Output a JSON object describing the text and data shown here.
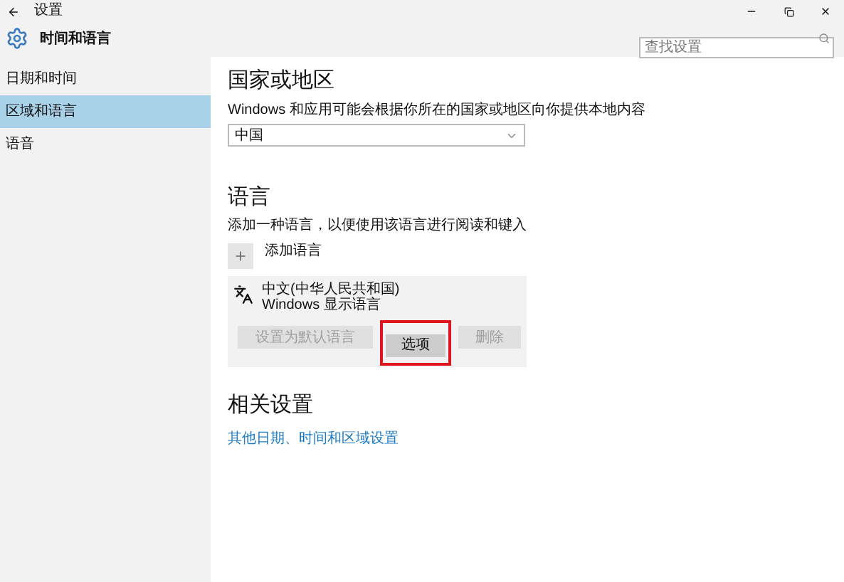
{
  "window": {
    "title": "设置"
  },
  "header": {
    "title": "时间和语言",
    "search": {
      "placeholder": "查找设置"
    }
  },
  "sidebar": {
    "items": [
      {
        "label": "日期和时间",
        "selected": false
      },
      {
        "label": "区域和语言",
        "selected": true
      },
      {
        "label": "语音",
        "selected": false
      }
    ]
  },
  "region": {
    "heading": "国家或地区",
    "description": "Windows 和应用可能会根据你所在的国家或地区向你提供本地内容",
    "dropdown": {
      "value": "中国"
    }
  },
  "language": {
    "heading": "语言",
    "description": "添加一种语言，以便使用该语言进行阅读和键入",
    "add_label": "添加语言",
    "items": [
      {
        "name": "中文(中华人民共和国)",
        "subtitle": "Windows 显示语言",
        "buttons": [
          {
            "label": "设置为默认语言",
            "disabled": true,
            "highlighted": false
          },
          {
            "label": "选项",
            "disabled": false,
            "highlighted": true
          },
          {
            "label": "删除",
            "disabled": true,
            "highlighted": false
          }
        ]
      }
    ]
  },
  "related": {
    "heading": "相关设置",
    "link": "其他日期、时间和区域设置"
  }
}
